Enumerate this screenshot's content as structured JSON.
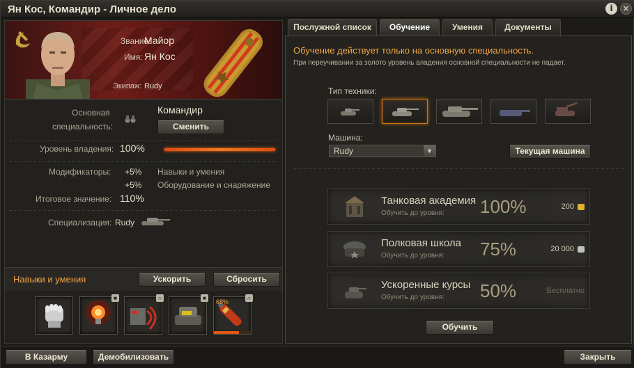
{
  "window": {
    "title": "Ян Кос, Командир - Личное дело"
  },
  "colors": {
    "accent_orange": "#f2a444",
    "selected_border": "#c9781f",
    "gold": "#e0b030",
    "silver": "#c0c0c0"
  },
  "icons": {
    "info": "i",
    "close": "×"
  },
  "profile": {
    "rank_label": "Звание:",
    "rank_value": "Майор",
    "name_label": "Имя:",
    "name_value": "Ян Кос",
    "crew_label": "Экипаж:",
    "crew_value": "Rudy"
  },
  "specialty": {
    "main_label_1": "Основная",
    "main_label_2": "специальность:",
    "main_value": "Командир",
    "change_button": "Сменить",
    "mastery_label": "Уровень владения:",
    "mastery_value": "100%",
    "mastery_fraction": 1.0,
    "modifiers_label": "Модификаторы:",
    "modifiers": [
      {
        "value": "+5%",
        "text": "Навыки и умения"
      },
      {
        "value": "+5%",
        "text": "Оборудование и снаряжение"
      }
    ],
    "total_label": "Итоговое значение:",
    "total_value": "110%",
    "specialization_label": "Специализация:",
    "specialization_value": "Rudy"
  },
  "skills": {
    "header": "Навыки и умения",
    "accelerate_button": "Ускорить",
    "reset_button": "Сбросить",
    "items": [
      {
        "icon": "fist-icon",
        "locked": false
      },
      {
        "icon": "lightbulb-icon",
        "locked": true
      },
      {
        "icon": "radio-icon",
        "locked": false
      },
      {
        "icon": "tank-repair-icon",
        "locked": true
      },
      {
        "icon": "fire-extinguisher-icon",
        "locked": false,
        "progress_text": "68%",
        "progress": 0.68
      }
    ]
  },
  "tabs": [
    {
      "label": "Послужной список",
      "active": false
    },
    {
      "label": "Обучение",
      "active": true
    },
    {
      "label": "Умения",
      "active": false
    },
    {
      "label": "Документы",
      "active": false
    }
  ],
  "training": {
    "note": "Обучение действует только на основную специальность.",
    "subnote": "При переучивании за золото уровень владения основной специальности не падает.",
    "vehicle_type_label": "Тип техники:",
    "vehicle_types": [
      {
        "icon": "light-tank-icon",
        "selected": false
      },
      {
        "icon": "medium-tank-icon",
        "selected": true
      },
      {
        "icon": "heavy-tank-icon",
        "selected": false
      },
      {
        "icon": "td-icon",
        "selected": false
      },
      {
        "icon": "spg-icon",
        "selected": false
      }
    ],
    "vehicle_label": "Машина:",
    "vehicle_value": "Rudy",
    "current_vehicle_button": "Текущая машина",
    "courses": [
      {
        "name": "Танковая академия",
        "sub": "Обучить до уровня:",
        "pct": "100%",
        "price": "200",
        "currency": "gold"
      },
      {
        "name": "Полковая школа",
        "sub": "Обучить до уровня:",
        "pct": "75%",
        "price": "20 000",
        "currency": "silver"
      },
      {
        "name": "Ускоренные курсы",
        "sub": "Обучить до уровня:",
        "pct": "50%",
        "price": "Бесплатно",
        "currency": "free"
      }
    ],
    "train_button": "Обучить"
  },
  "footer": {
    "barracks_button": "В Казарму",
    "demobilize_button": "Демобилизовать",
    "close_button": "Закрыть"
  }
}
